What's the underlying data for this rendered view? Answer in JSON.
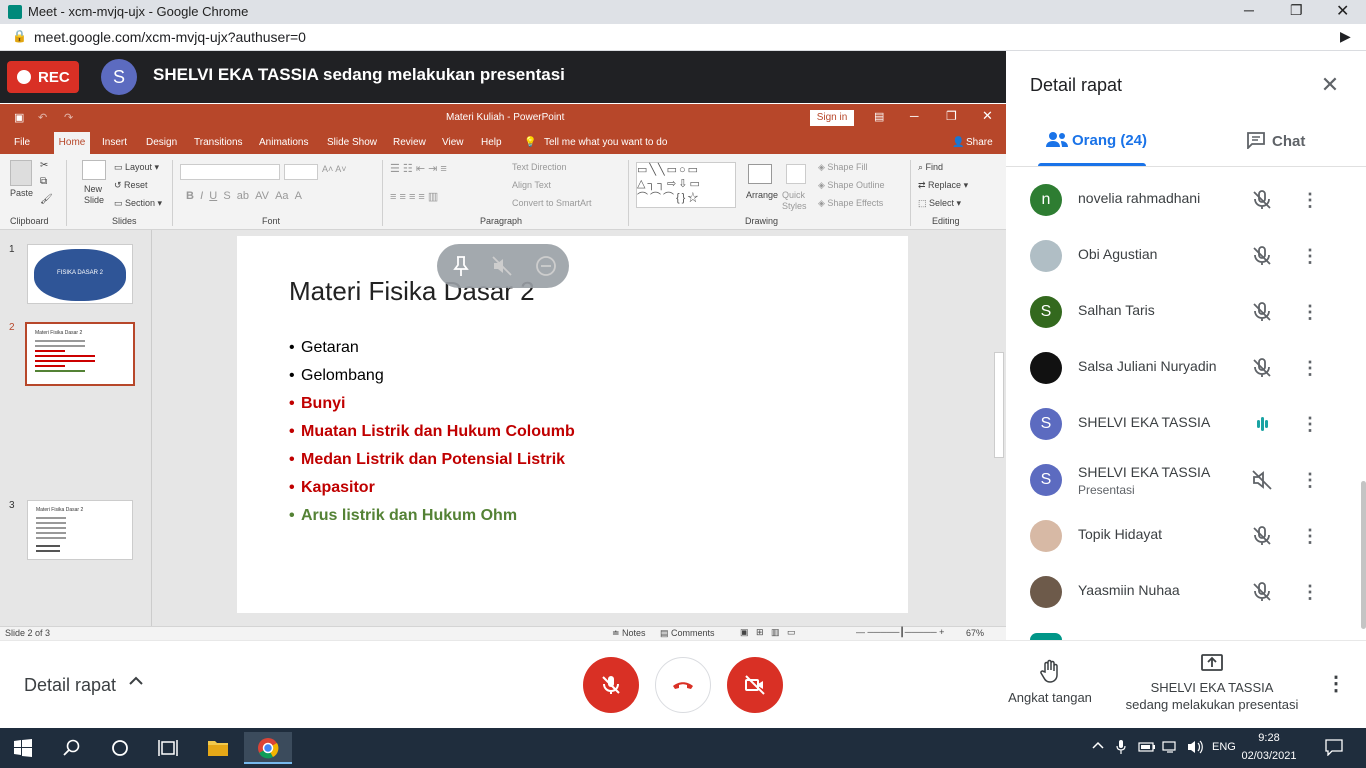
{
  "browser": {
    "tab_title": "Meet - xcm-mvjq-ujx - Google Chrome",
    "url": "meet.google.com/xcm-mvjq-ujx?authuser=0"
  },
  "meet_header": {
    "rec_label": "REC",
    "presenter_initial": "S",
    "presenting_text": "SHELVI EKA TASSIA sedang melakukan presentasi"
  },
  "powerpoint": {
    "title": "Materi Kuliah - PowerPoint",
    "sign_in": "Sign in",
    "tabs": [
      "File",
      "Home",
      "Insert",
      "Design",
      "Transitions",
      "Animations",
      "Slide Show",
      "Review",
      "View",
      "Help"
    ],
    "tell_me": "Tell me what you want to do",
    "share": "Share",
    "ribbon": {
      "paste": "Paste",
      "new_slide": "New Slide",
      "layout": "Layout",
      "reset": "Reset",
      "section": "Section",
      "text_direction": "Text Direction",
      "align_text": "Align Text",
      "convert_smartart": "Convert to SmartArt",
      "arrange": "Arrange",
      "quick_styles": "Quick Styles",
      "shape_fill": "Shape Fill",
      "shape_outline": "Shape Outline",
      "shape_effects": "Shape Effects",
      "find": "Find",
      "replace": "Replace",
      "select": "Select",
      "groups": [
        "Clipboard",
        "Slides",
        "Font",
        "Paragraph",
        "Drawing",
        "Editing"
      ]
    },
    "thumbnails": [
      {
        "num": "1",
        "text": "FISIKA DASAR 2"
      },
      {
        "num": "2",
        "text": "Materi Fisika Dasar 2"
      },
      {
        "num": "3",
        "text": "Materi Fisika Dasar 2"
      }
    ],
    "slide": {
      "title": "Materi Fisika Dasar 2",
      "bullets": [
        {
          "text": "Getaran",
          "color": "#222222"
        },
        {
          "text": "Gelombang",
          "color": "#222222"
        },
        {
          "text": "Bunyi",
          "color": "#c00000"
        },
        {
          "text": "Muatan Listrik dan Hukum Coloumb",
          "color": "#c00000"
        },
        {
          "text": "Medan Listrik dan Potensial Listrik",
          "color": "#c00000"
        },
        {
          "text": "Kapasitor",
          "color": "#c00000"
        },
        {
          "text": "Arus listrik dan Hukum Ohm",
          "color": "#548235"
        }
      ]
    },
    "status": {
      "slide_of": "Slide 2 of 3",
      "notes": "Notes",
      "comments": "Comments",
      "zoom": "67%"
    }
  },
  "panel": {
    "title": "Detail rapat",
    "tab_people": "Orang (24)",
    "tab_chat": "Chat",
    "participants": [
      {
        "initial": "n",
        "name": "novelia rahmadhani",
        "sub": "",
        "avatar_color": "#2e7d32",
        "mic": "muted"
      },
      {
        "initial": "",
        "name": "Obi Agustian",
        "sub": "",
        "avatar_color": "#b0bec5",
        "mic": "muted"
      },
      {
        "initial": "S",
        "name": "Salhan Taris",
        "sub": "",
        "avatar_color": "#33691e",
        "mic": "muted"
      },
      {
        "initial": "",
        "name": "Salsa Juliani Nuryadin",
        "sub": "",
        "avatar_color": "#111111",
        "mic": "muted"
      },
      {
        "initial": "S",
        "name": "SHELVI EKA TASSIA",
        "sub": "",
        "avatar_color": "#5c6bc0",
        "mic": "speaking"
      },
      {
        "initial": "S",
        "name": "SHELVI EKA TASSIA",
        "sub": "Presentasi",
        "avatar_color": "#5c6bc0",
        "mic": "volume-off"
      },
      {
        "initial": "",
        "name": "Topik Hidayat",
        "sub": "",
        "avatar_color": "#d7b9a5",
        "mic": "muted"
      },
      {
        "initial": "",
        "name": "Yaasmiin Nuhaa",
        "sub": "",
        "avatar_color": "#6d5a4a",
        "mic": "muted"
      }
    ]
  },
  "bottom": {
    "details_label": "Detail rapat",
    "raise_hand": "Angkat tangan",
    "presenting_name": "SHELVI EKA TASSIA",
    "presenting_sub": "sedang melakukan presentasi"
  },
  "taskbar": {
    "lang": "ENG",
    "time": "9:28",
    "date": "02/03/2021"
  }
}
